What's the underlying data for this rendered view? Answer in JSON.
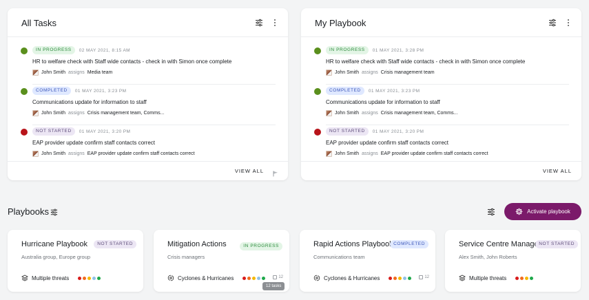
{
  "colors": {
    "status_green": "#5a8f1d",
    "status_red": "#b8141a",
    "accent": "#7b1a6a",
    "threat_dots": [
      "#d81b1b",
      "#f26b1d",
      "#f5b800",
      "#8fc1e8",
      "#1ea84a"
    ]
  },
  "all_tasks": {
    "title": "All Tasks",
    "view_all": "VIEW ALL",
    "tasks": [
      {
        "status": "IN PROGRESS",
        "timestamp": "02 MAY 2021, 8:15 AM",
        "title": "HR to welfare check with Staff wide contacts - check in with Simon once complete",
        "assigner": "John Smith",
        "verb": "assigns",
        "assignees": "Media team"
      },
      {
        "status": "COMPLETED",
        "timestamp": "01 MAY 2021, 3:23 PM",
        "title": "Communications update for information to staff",
        "assigner": "John Smith",
        "verb": "assigns",
        "assignees": "Crisis management team, Comms..."
      },
      {
        "status": "NOT STARTED",
        "timestamp": "01 MAY 2021, 3:20 PM",
        "title": "EAP provider update confirm staff contacts correct",
        "assigner": "John Smith",
        "verb": "assigns",
        "assignees": "EAP provider update confirm staff contacts correct"
      }
    ]
  },
  "my_playbook": {
    "title": "My Playbook",
    "view_all": "VIEW ALL",
    "tasks": [
      {
        "status": "IN PROGRESS",
        "timestamp": "01 MAY 2021, 3:28 PM",
        "title": "HR to welfare check with Staff wide contacts - check in with Simon once complete",
        "assigner": "John Smith",
        "verb": "assigns",
        "assignees": "Crisis management team"
      },
      {
        "status": "COMPLETED",
        "timestamp": "01 MAY 2021, 3:23 PM",
        "title": "Communications update for information to staff",
        "assigner": "John Smith",
        "verb": "assigns",
        "assignees": "Crisis management team, Comms..."
      },
      {
        "status": "NOT STARTED",
        "timestamp": "01 MAY 2021, 3:20 PM",
        "title": "EAP provider update confirm staff contacts correct",
        "assigner": "John Smith",
        "verb": "assigns",
        "assignees": "EAP provider update confirm staff contacts correct"
      }
    ]
  },
  "playbooks": {
    "title": "Playbooks",
    "activate_label": "Activate playbook",
    "tooltip": "12 tasks",
    "cards": [
      {
        "title": "Hurricane Playbook",
        "status": "NOT STARTED",
        "subtitle": "Australia group, Europe group",
        "threat_icon": "layers-icon",
        "threat": "Multiple threats",
        "count": ""
      },
      {
        "title": "Mitigation Actions",
        "status": "IN PROGRESS",
        "subtitle": "Crisis managers",
        "threat_icon": "cyclone-icon",
        "threat": "Cyclones & Hurricanes",
        "count": "12"
      },
      {
        "title": "Rapid Actions Playbook",
        "status": "COMPLETED",
        "subtitle": "Communications team",
        "threat_icon": "cyclone-icon",
        "threat": "Cyclones & Hurricanes",
        "count": "12"
      },
      {
        "title": "Service Centre Manager",
        "status": "NOT STARTED",
        "subtitle": "Alex Smith, John Roberts",
        "threat_icon": "layers-icon",
        "threat": "Multiple threats",
        "count": ""
      }
    ]
  }
}
